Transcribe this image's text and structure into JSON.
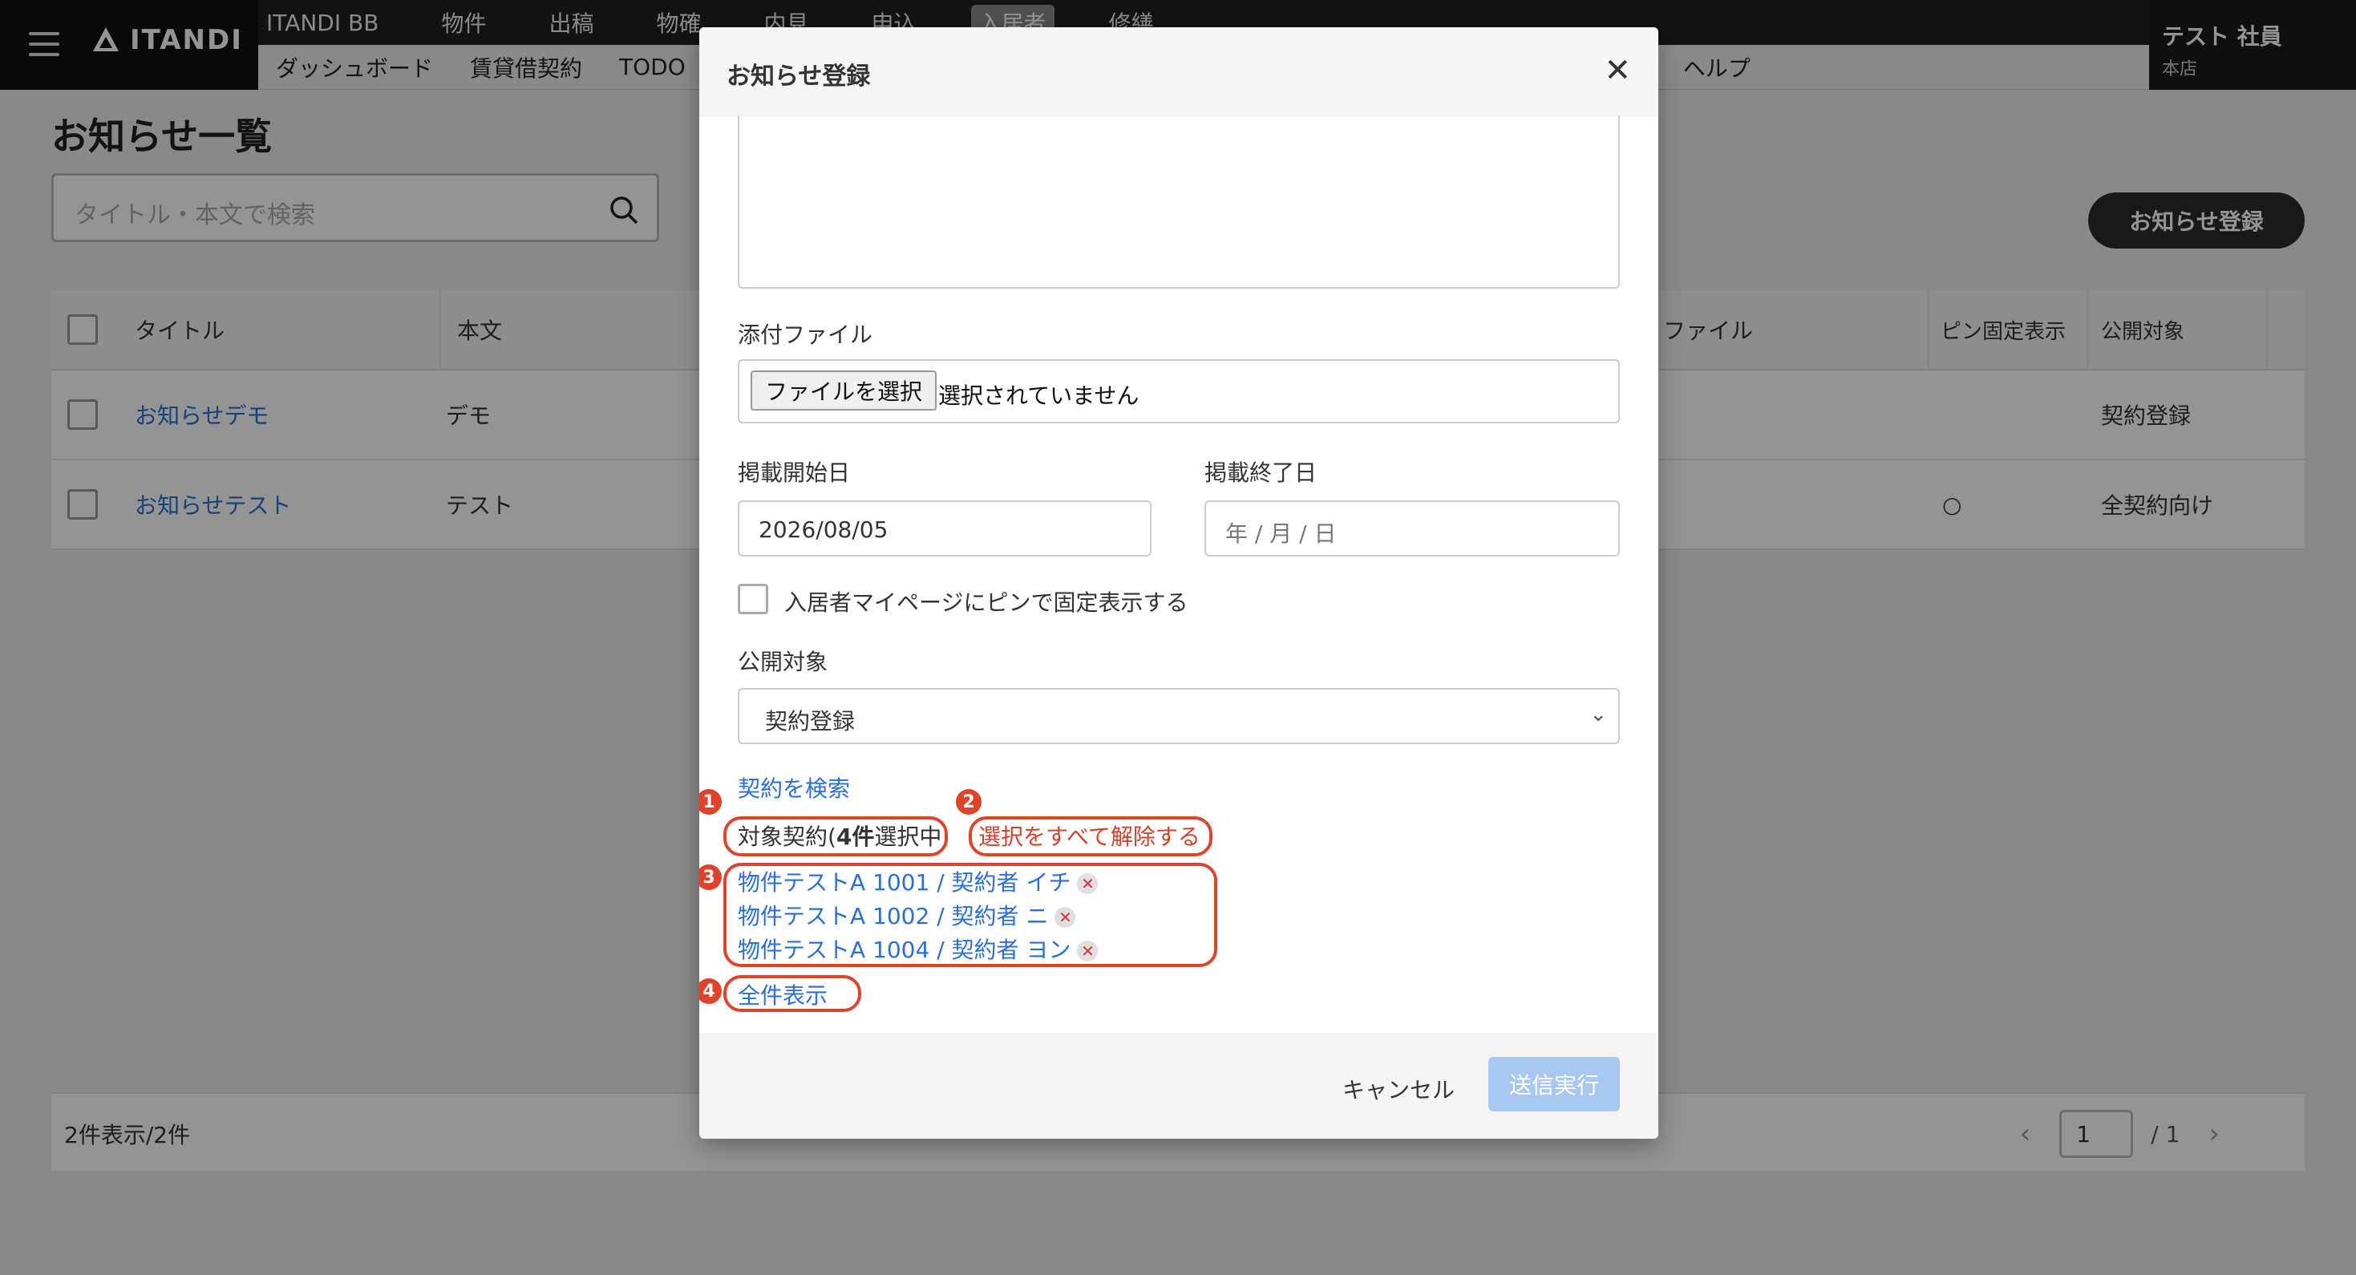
{
  "header": {
    "logo_text": "ITANDI",
    "nav_top": [
      "ITANDI BB",
      "物件",
      "出稿",
      "物確",
      "内見",
      "申込",
      "入居者",
      "修繕"
    ],
    "nav_bottom": [
      "ダッシュボード",
      "賃貸借契約",
      "TODO",
      "ヘルプ"
    ],
    "user_name": "テスト 社員",
    "user_branch": "本店"
  },
  "page": {
    "title": "お知らせ一覧",
    "search_placeholder": "タイトル・本文で検索",
    "register_button": "お知らせ登録"
  },
  "table": {
    "columns": [
      "タイトル",
      "本文",
      "ファイル",
      "ピン固定表示",
      "公開対象"
    ],
    "rows": [
      {
        "title": "お知らせデモ",
        "body": "デモ",
        "pin": "",
        "target": "契約登録"
      },
      {
        "title": "お知らせテスト",
        "body": "テスト",
        "pin": "○",
        "target": "全契約向け"
      }
    ],
    "count_text": "2件表示/2件",
    "page_current": "1",
    "page_total": "/ 1"
  },
  "modal": {
    "title": "お知らせ登録",
    "attach_label": "添付ファイル",
    "file_button": "ファイルを選択",
    "file_status": "選択されていません",
    "start_label": "掲載開始日",
    "start_value": "2026/08/05",
    "end_label": "掲載終了日",
    "end_placeholder": "年 / 月 / 日",
    "pin_label": "入居者マイページにピンで固定表示する",
    "target_label": "公開対象",
    "target_value": "契約登録",
    "search_contract": "契約を検索",
    "selected_prefix": "対象契約(",
    "selected_count": "4件",
    "selected_suffix": "選択中",
    "clear_all": "選択をすべて解除する",
    "contracts": [
      "物件テストA 1001 / 契約者 イチ",
      "物件テストA 1002 / 契約者 ニ",
      "物件テストA 1004 / 契約者 ヨン"
    ],
    "show_all": "全件表示",
    "cancel": "キャンセル",
    "submit": "送信実行"
  },
  "annotations": [
    "1",
    "2",
    "3",
    "4"
  ],
  "colors": {
    "accent": "#2a6fd8",
    "annotation": "#e0432b",
    "submit_disabled": "#a9c8ef"
  }
}
